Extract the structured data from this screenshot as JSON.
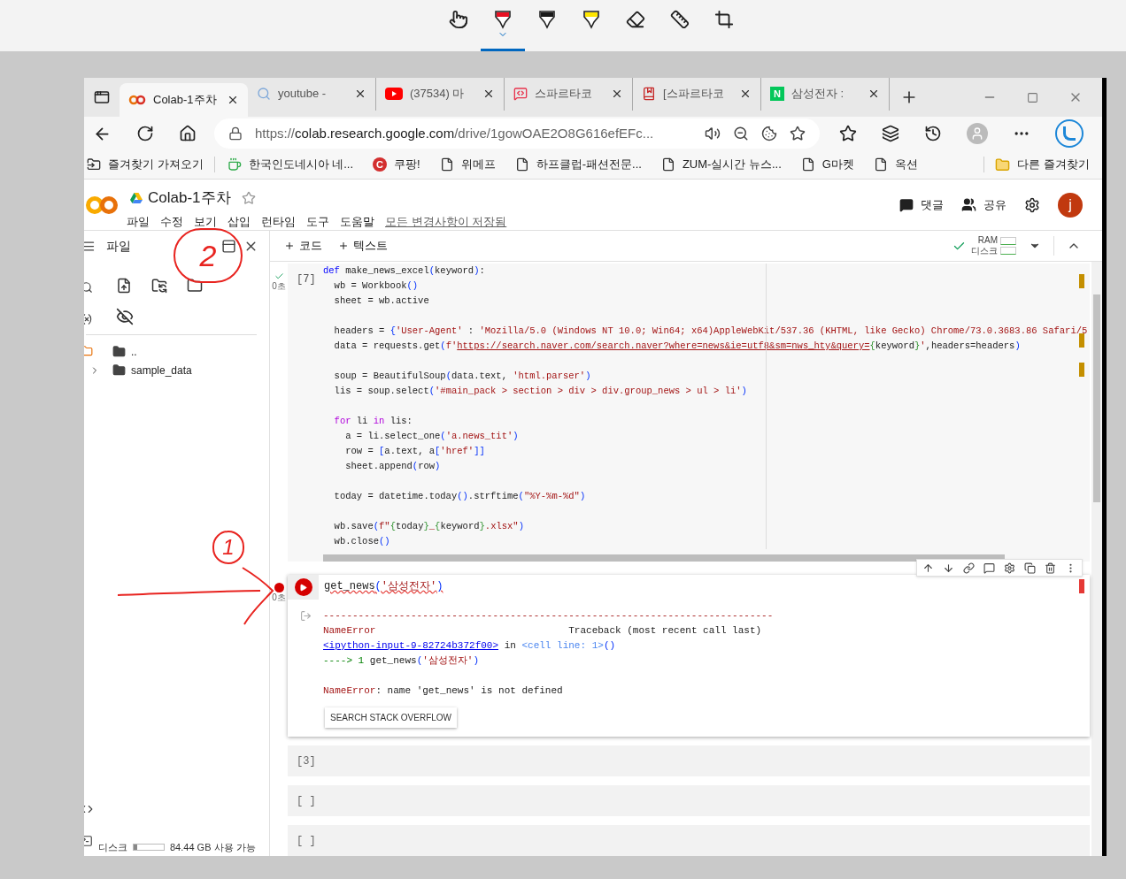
{
  "snip_toolbar": {
    "tools": [
      {
        "kind": "touch",
        "selected": false
      },
      {
        "kind": "pen",
        "color": "#e81123",
        "selected": true
      },
      {
        "kind": "pen",
        "color": "#1a1a1a",
        "selected": false
      },
      {
        "kind": "highlighter",
        "color": "#ffe600",
        "selected": false
      },
      {
        "kind": "eraser",
        "selected": false
      },
      {
        "kind": "ruler",
        "selected": false
      },
      {
        "kind": "crop",
        "selected": false
      }
    ]
  },
  "browser": {
    "tabs": [
      {
        "kind": "colab",
        "title": "Colab-1주차",
        "selected": true
      },
      {
        "kind": "search",
        "title": "youtube -",
        "selected": false
      },
      {
        "kind": "youtube",
        "title": "(37534) 마",
        "selected": false
      },
      {
        "kind": "sparta",
        "title": "스파르타코",
        "selected": false
      },
      {
        "kind": "book",
        "title": "[스파르타코",
        "selected": false
      },
      {
        "kind": "letter",
        "badge": "N",
        "title": "삼성전자 :",
        "selected": false
      }
    ],
    "address": {
      "scheme": "https://",
      "host": "colab.research.google.com",
      "path": "/drive/1gowOAE2O8G616efEFc..."
    },
    "bookmarks": [
      {
        "kind": "import",
        "label": "즐겨찾기 가져오기"
      },
      {
        "kind": "cup",
        "label": "한국인도네시아 네..."
      },
      {
        "kind": "letter",
        "badge": "C",
        "label": "쿠팡!"
      },
      {
        "kind": "page",
        "label": "위메프"
      },
      {
        "kind": "page",
        "label": "하프클럽-패션전문..."
      },
      {
        "kind": "page",
        "label": "ZUM-실시간 뉴스..."
      },
      {
        "kind": "page",
        "label": "G마켓"
      },
      {
        "kind": "page",
        "label": "옥션"
      }
    ],
    "other_bookmarks": "다른 즐겨찾기"
  },
  "notebook": {
    "title": "Colab-1주차",
    "menu": [
      "파일",
      "수정",
      "보기",
      "삽입",
      "런타임",
      "도구",
      "도움말"
    ],
    "save_status": "모든 변경사항이 저장됨",
    "comment_button": "댓글",
    "share_button": "공유",
    "avatar": "j"
  },
  "toolbar": {
    "add_code": "코드",
    "add_text": "텍스트",
    "ram_label": "RAM",
    "disk_label": "디스크",
    "connected": true
  },
  "sidebar": {
    "title": "파일",
    "tree": [
      {
        "kind": "parent",
        "name": ".."
      },
      {
        "kind": "folder",
        "name": "sample_data",
        "expanded": false
      }
    ],
    "disk": {
      "label": "디스크",
      "level": 0.12,
      "free": "84.44 GB 사용 가능"
    }
  },
  "cells": [
    {
      "kind": "code",
      "count": "[7]",
      "error": false,
      "time": "0초",
      "blocks": [
        [
          [
            {
              "kind": "def",
              "text": "def"
            },
            {
              "kind": "plain",
              "text": " make_news_excel"
            },
            {
              "kind": "bracket",
              "text": "("
            },
            {
              "kind": "plain",
              "text": "keyword"
            },
            {
              "kind": "bracket",
              "text": ")"
            },
            {
              "kind": "plain",
              "text": ":"
            }
          ],
          [
            {
              "kind": "plain",
              "text": "  wb = Workbook"
            },
            {
              "kind": "bracket",
              "text": "()"
            }
          ],
          [
            {
              "kind": "plain",
              "text": "  sheet = wb.active"
            }
          ]
        ],
        [
          [
            {
              "kind": "plain",
              "text": "  headers = "
            },
            {
              "kind": "bracket",
              "text": "{"
            },
            {
              "kind": "string",
              "text": "'User-Agent'"
            },
            {
              "kind": "plain",
              "text": " : "
            },
            {
              "kind": "string",
              "text": "'Mozilla/5.0 (Windows NT 10.0; Win64; x64)AppleWebKit/537.36 (KHTML, like Gecko) Chrome/73.0.3683.86 Safari/5"
            }
          ],
          [
            {
              "kind": "plain",
              "text": "  data = requests.get"
            },
            {
              "kind": "bracket",
              "text": "("
            },
            {
              "kind": "string",
              "text": "f'"
            },
            {
              "kind": "url",
              "text": "https://search.naver.com/search.naver?where=news&ie=utf8&sm=nws_hty&query="
            },
            {
              "kind": "interp",
              "text": "{"
            },
            {
              "kind": "plain",
              "text": "keyword"
            },
            {
              "kind": "interp",
              "text": "}"
            },
            {
              "kind": "string",
              "text": "'"
            },
            {
              "kind": "plain",
              "text": ",headers=headers"
            },
            {
              "kind": "bracket",
              "text": ")"
            }
          ]
        ],
        [
          [
            {
              "kind": "plain",
              "text": "  soup = BeautifulSoup"
            },
            {
              "kind": "bracket",
              "text": "("
            },
            {
              "kind": "plain",
              "text": "data.text, "
            },
            {
              "kind": "string",
              "text": "'html.parser'"
            },
            {
              "kind": "bracket",
              "text": ")"
            }
          ],
          [
            {
              "kind": "plain",
              "text": "  lis = soup.select"
            },
            {
              "kind": "bracket",
              "text": "("
            },
            {
              "kind": "string",
              "text": "'#main_pack > section > div > div.group_news > ul > li'"
            },
            {
              "kind": "bracket",
              "text": ")"
            }
          ]
        ],
        [
          [
            {
              "kind": "keyword",
              "text": "  for"
            },
            {
              "kind": "plain",
              "text": " li "
            },
            {
              "kind": "keyword",
              "text": "in"
            },
            {
              "kind": "plain",
              "text": " lis:"
            }
          ],
          [
            {
              "kind": "plain",
              "text": "    a = li.select_one"
            },
            {
              "kind": "bracket",
              "text": "("
            },
            {
              "kind": "string",
              "text": "'a.news_tit'"
            },
            {
              "kind": "bracket",
              "text": ")"
            }
          ],
          [
            {
              "kind": "plain",
              "text": "    row = "
            },
            {
              "kind": "bracket",
              "text": "["
            },
            {
              "kind": "plain",
              "text": "a.text, a"
            },
            {
              "kind": "bracket",
              "text": "["
            },
            {
              "kind": "string",
              "text": "'href'"
            },
            {
              "kind": "bracket",
              "text": "]]"
            }
          ],
          [
            {
              "kind": "plain",
              "text": "    sheet.append"
            },
            {
              "kind": "bracket",
              "text": "("
            },
            {
              "kind": "plain",
              "text": "row"
            },
            {
              "kind": "bracket",
              "text": ")"
            }
          ]
        ],
        [
          [
            {
              "kind": "plain",
              "text": "  today = datetime.today"
            },
            {
              "kind": "bracket",
              "text": "()"
            },
            {
              "kind": "plain",
              "text": ".strftime"
            },
            {
              "kind": "bracket",
              "text": "("
            },
            {
              "kind": "string",
              "text": "\"%Y-%m-%d\""
            },
            {
              "kind": "bracket",
              "text": ")"
            }
          ]
        ],
        [
          [
            {
              "kind": "plain",
              "text": "  wb.save"
            },
            {
              "kind": "bracket",
              "text": "("
            },
            {
              "kind": "string",
              "text": "f\""
            },
            {
              "kind": "interp",
              "text": "{"
            },
            {
              "kind": "plain",
              "text": "today"
            },
            {
              "kind": "interp",
              "text": "}"
            },
            {
              "kind": "string",
              "text": "_"
            },
            {
              "kind": "interp",
              "text": "{"
            },
            {
              "kind": "plain",
              "text": "keyword"
            },
            {
              "kind": "interp",
              "text": "}"
            },
            {
              "kind": "string",
              "text": ".xlsx\""
            },
            {
              "kind": "bracket",
              "text": ")"
            }
          ],
          [
            {
              "kind": "plain",
              "text": "  wb.close"
            },
            {
              "kind": "bracket",
              "text": "()"
            }
          ]
        ]
      ]
    },
    {
      "kind": "code",
      "error": true,
      "time": "0초",
      "blocks": [
        [
          [
            {
              "kind": "plain",
              "text": "get_news"
            },
            {
              "kind": "bracket",
              "text": "("
            },
            {
              "kind": "string",
              "text": "'삼성전자'"
            },
            {
              "kind": "bracket",
              "text": ")"
            }
          ]
        ]
      ],
      "output": {
        "blocks": [
          [
            [
              {
                "kind": "error",
                "text": "-----------------------------------------------------------------------------"
              }
            ],
            [
              {
                "kind": "error",
                "text": "NameError"
              },
              {
                "kind": "plain",
                "text": "                                 Traceback (most recent call last)"
              }
            ],
            [
              {
                "kind": "link",
                "text": "<ipython-input-9-82724b372f00>"
              },
              {
                "kind": "plain",
                "text": " in "
              },
              {
                "kind": "cellref",
                "text": "<cell line: 1>"
              },
              {
                "kind": "bracket",
                "text": "()"
              }
            ],
            [
              {
                "kind": "arrow",
                "text": "----> 1"
              },
              {
                "kind": "plain",
                "text": " get_news"
              },
              {
                "kind": "bracket",
                "text": "("
              },
              {
                "kind": "string",
                "text": "'삼성전자'"
              },
              {
                "kind": "bracket",
                "text": ")"
              }
            ]
          ],
          [
            [
              {
                "kind": "error",
                "text": "NameError"
              },
              {
                "kind": "plain",
                "text": ": name 'get_news' is not defined"
              }
            ]
          ]
        ],
        "button": "SEARCH STACK OVERFLOW"
      }
    },
    {
      "kind": "empty",
      "count": "[3]"
    },
    {
      "kind": "empty",
      "count": "[ ]"
    },
    {
      "kind": "empty",
      "count": "[ ]"
    }
  ],
  "annotations": [
    {
      "label": "2"
    },
    {
      "label": "1"
    }
  ]
}
